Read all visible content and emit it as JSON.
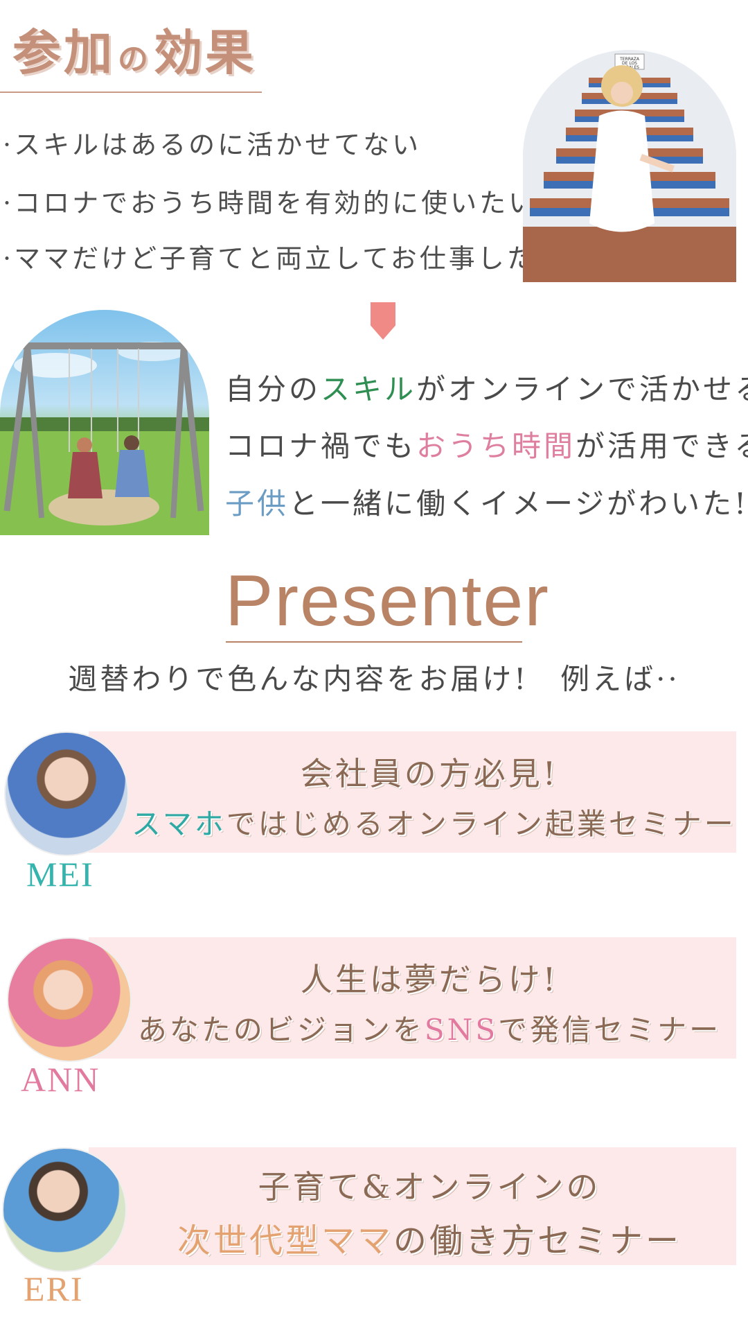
{
  "header": {
    "title_part1": "参加",
    "title_particle": "の",
    "title_part2": "効果"
  },
  "concerns": [
    "·スキルはあるのに活かせてない",
    "·コロナでおうち時間を有効的に使いたい",
    "·ママだけど子育てと両立してお仕事したい"
  ],
  "stairs_sign": "TERRAZA DE LOS CORALES",
  "benefits": {
    "b1": {
      "pre": "自分の",
      "hl": "スキル",
      "post": "がオンラインで活かせる!"
    },
    "b2": {
      "pre": "コロナ禍でも",
      "hl": "おうち時間",
      "post": "が活用できる!"
    },
    "b3": {
      "pre": "",
      "hl": "子供",
      "post": "と一緒に働くイメージがわいた!"
    }
  },
  "presenter": {
    "title": "Presenter",
    "subtitle": "週替わりで色んな内容をお届け!　例えば··"
  },
  "seminars": [
    {
      "name": "MEI",
      "line1": "会社員の方必見!",
      "line2_hl": "スマホ",
      "line2_rest": "ではじめるオンライン起業セミナー"
    },
    {
      "name": "ANN",
      "line1": "人生は夢だらけ!",
      "line2_pre": "あなたのビジョンを",
      "line2_hl": "SNS",
      "line2_post": "で発信セミナー"
    },
    {
      "name": "ERI",
      "line1": "子育て&オンラインの",
      "line2_hl": "次世代型ママ",
      "line2_rest": "の働き方セミナー"
    }
  ],
  "colors": {
    "title": "#c4907a",
    "green": "#2f8e52",
    "pink": "#df7fa0",
    "blue": "#6b9cc4",
    "teal": "#2fa9a4",
    "orange": "#e3a270",
    "band": "#fde9ea",
    "brown": "#8b6a55"
  }
}
